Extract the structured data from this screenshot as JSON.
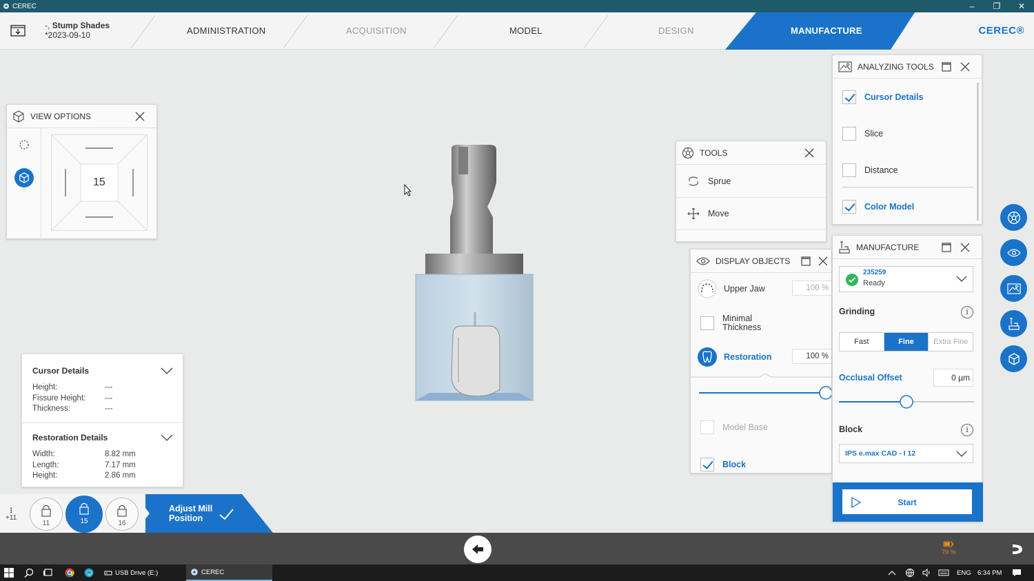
{
  "window": {
    "title": "CEREC",
    "controls": [
      "–",
      "❐",
      "✕"
    ]
  },
  "case": {
    "name": "Stump Shades",
    "date": "2023-09-10",
    "name_prefix": "-,",
    "date_prefix": "*"
  },
  "workflow": {
    "steps": [
      {
        "label": "ADMINISTRATION"
      },
      {
        "label": "ACQUISITION"
      },
      {
        "label": "MODEL"
      },
      {
        "label": "DESIGN"
      },
      {
        "label": "MANUFACTURE"
      }
    ],
    "active": "MANUFACTURE",
    "brand": "CEREC®"
  },
  "view_options": {
    "title": "VIEW OPTIONS",
    "center_number": "15"
  },
  "cursor_details": {
    "title": "Cursor Details",
    "rows": [
      {
        "label": "Height:",
        "value": "---"
      },
      {
        "label": "Fissure Height:",
        "value": "---"
      },
      {
        "label": "Thickness:",
        "value": "---"
      }
    ]
  },
  "restoration_details": {
    "title": "Restoration Details",
    "rows": [
      {
        "label": "Width:",
        "value": "8.82 mm"
      },
      {
        "label": "Length:",
        "value": "7.17 mm"
      },
      {
        "label": "Height:",
        "value": "2.86 mm"
      }
    ]
  },
  "tooth_bar": {
    "more_label": "+11",
    "teeth": [
      {
        "num": "11"
      },
      {
        "num": "15"
      },
      {
        "num": "16"
      }
    ],
    "active_tooth": "15",
    "adjust_label": "Adjust Mill Position"
  },
  "tools": {
    "title": "TOOLS",
    "items": [
      {
        "label": "Sprue"
      },
      {
        "label": "Move"
      }
    ]
  },
  "display_objects": {
    "title": "DISPLAY OBJECTS",
    "upper_jaw": {
      "label": "Upper Jaw",
      "pct": "100 %"
    },
    "minimal_thickness": {
      "label": "Minimal Thickness"
    },
    "restoration": {
      "label": "Restoration",
      "pct": "100 %"
    },
    "transparency_level": 1.0,
    "model_base": {
      "label": "Model Base"
    },
    "block": {
      "label": "Block"
    }
  },
  "analyzing_tools": {
    "title": "ANALYZING TOOLS",
    "items": [
      {
        "label": "Cursor Details",
        "checked": true
      },
      {
        "label": "Slice",
        "checked": false
      },
      {
        "label": "Distance",
        "checked": false
      },
      {
        "label": "Color Model",
        "checked": true
      }
    ]
  },
  "manufacture": {
    "title": "MANUFACTURE",
    "machine": {
      "id": "235259",
      "status": "Ready"
    },
    "grinding_label": "Grinding",
    "grinding_options": [
      "Fast",
      "Fine",
      "Extra Fine"
    ],
    "grinding_selected": "Fine",
    "occlusal_offset_label": "Occlusal Offset",
    "occlusal_offset_value": "0 µm",
    "occlusal_offset_level": 0.5,
    "block_label": "Block",
    "block_value": "IPS e.max CAD - I 12",
    "start_label": "Start",
    "info_glyph": "i"
  },
  "status": {
    "battery": "79 %"
  },
  "taskbar": {
    "usb_label": "USB Drive (E:)",
    "cerec_label": "CEREC",
    "lang": "ENG",
    "time": "6:34 PM"
  },
  "colors": {
    "accent": "#1a73c8",
    "titlebar": "#1f5a6b",
    "header_bg": "#f4f4f4",
    "canvas_bg": "#e9eaea",
    "status_ok": "#2eb85c",
    "battery": "#e08a1e"
  }
}
